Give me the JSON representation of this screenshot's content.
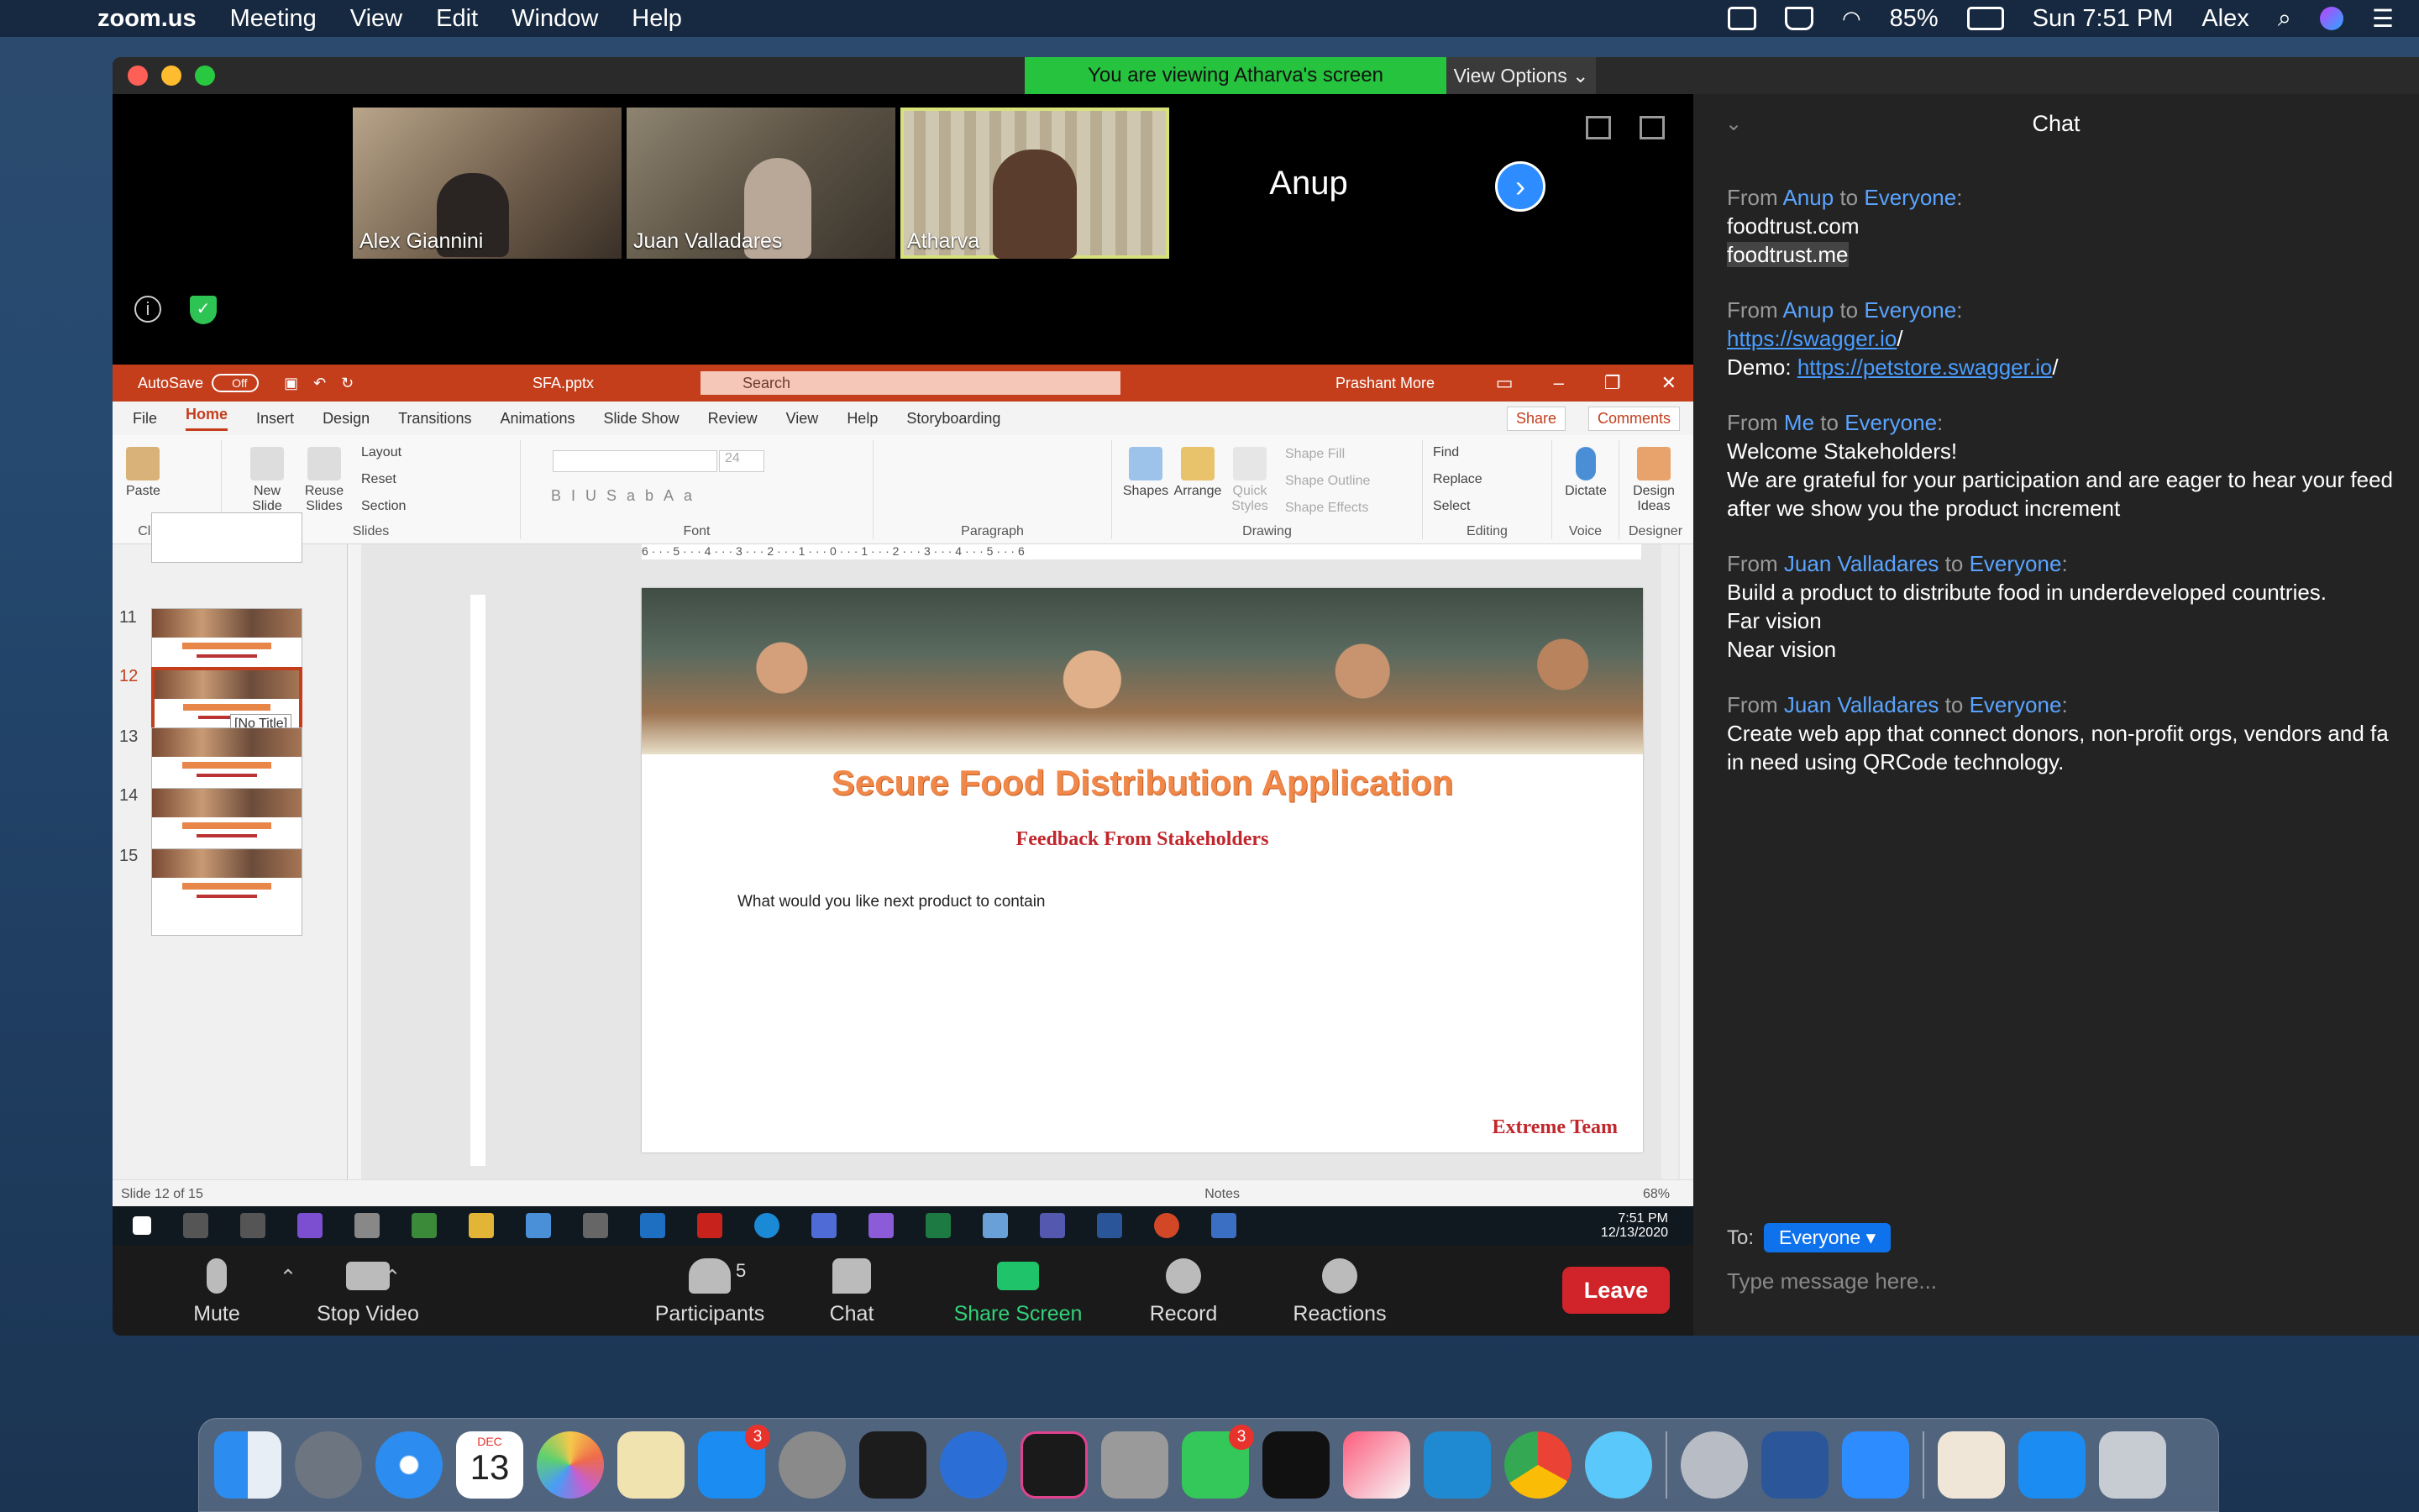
{
  "menubar": {
    "app": "zoom.us",
    "items": [
      "Meeting",
      "View",
      "Edit",
      "Window",
      "Help"
    ],
    "battery": "85%",
    "datetime": "Sun 7:51 PM",
    "user": "Alex"
  },
  "zoom": {
    "banner": "You are viewing Atharva's screen",
    "view_options": "View Options",
    "participants": [
      {
        "name": "Alex Giannini"
      },
      {
        "name": "Juan Valladares"
      },
      {
        "name": "Atharva"
      },
      {
        "name": "Anup"
      }
    ],
    "toolbar": {
      "mute": "Mute",
      "stop_video": "Stop Video",
      "participants": "Participants",
      "participants_count": "5",
      "chat": "Chat",
      "share_screen": "Share Screen",
      "record": "Record",
      "reactions": "Reactions",
      "leave": "Leave"
    }
  },
  "powerpoint": {
    "autosave": "AutoSave",
    "autosave_state": "Off",
    "filename": "SFA.pptx",
    "search": "Search",
    "user": "Prashant More",
    "tabs": [
      "File",
      "Home",
      "Insert",
      "Design",
      "Transitions",
      "Animations",
      "Slide Show",
      "Review",
      "View",
      "Help",
      "Storyboarding"
    ],
    "share": "Share",
    "comments": "Comments",
    "ribbon": {
      "paste": "Paste",
      "new_slide": "New Slide",
      "reuse_slides": "Reuse Slides",
      "layout": "Layout",
      "reset": "Reset",
      "section": "Section",
      "shapes": "Shapes",
      "arrange": "Arrange",
      "quick_styles": "Quick Styles",
      "shape_fill": "Shape Fill",
      "shape_outline": "Shape Outline",
      "shape_effects": "Shape Effects",
      "find": "Find",
      "replace": "Replace",
      "select": "Select",
      "dictate": "Dictate",
      "design_ideas": "Design Ideas",
      "font_size": "24",
      "groups": [
        "Clipboard",
        "Slides",
        "Font",
        "Paragraph",
        "Drawing",
        "Editing",
        "Voice",
        "Designer"
      ]
    },
    "thumbnails": [
      "11",
      "12",
      "13",
      "14",
      "15"
    ],
    "no_title": "[No Title]",
    "slide": {
      "title": "Secure Food Distribution Application",
      "subtitle": "Feedback From Stakeholders",
      "body": "What would you like next product to contain",
      "footer": "Extreme Team"
    },
    "ruler": "6 · · · 5 · · · 4 · · · 3 · · · 2 · · · 1 · · · 0 · · · 1 · · · 2 · · · 3 · · · 4 · · · 5 · · · 6",
    "status": "Slide 12 of 15",
    "notes": "Notes",
    "zoom": "68%"
  },
  "windows": {
    "time": "7:51 PM",
    "date": "12/13/2020"
  },
  "chat": {
    "title": "Chat",
    "messages": [
      {
        "from": "Anup",
        "to": "Everyone",
        "lines": [
          "foodtrust.com",
          "foodtrust.me"
        ]
      },
      {
        "from": "Anup",
        "to": "Everyone",
        "link1": "https://swagger.io",
        "demo_label": "Demo: ",
        "link2": "https://petstore.swagger.io"
      },
      {
        "from": "Me",
        "to": "Everyone",
        "lines": [
          "Welcome Stakeholders!",
          "We are grateful for your participation and are eager to hear your feed",
          "after we show you the product increment"
        ]
      },
      {
        "from": "Juan Valladares",
        "to": "Everyone",
        "lines": [
          "Build a product to distribute food in underdeveloped countries.",
          "Far vision",
          "Near vision"
        ]
      },
      {
        "from": "Juan Valladares",
        "to": "Everyone",
        "lines": [
          "Create web app that connect donors, non-profit orgs, vendors and fa",
          "in need using QRCode technology."
        ]
      }
    ],
    "from_label": "From",
    "to_label": "to",
    "send_to_label": "To:",
    "recipient": "Everyone",
    "placeholder": "Type message here..."
  },
  "dock": {
    "calendar_month": "DEC",
    "calendar_day": "13",
    "appstore_badge": "3",
    "facetime_badge": "3"
  }
}
